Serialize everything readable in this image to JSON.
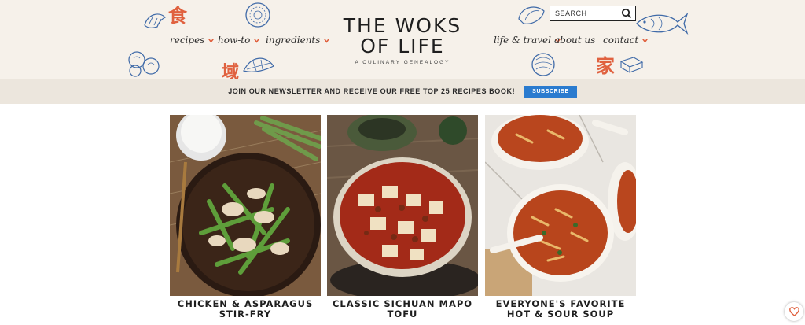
{
  "site": {
    "logo_line1": "THE WOKS",
    "logo_line2": "OF LIFE",
    "tagline": "A CULINARY GENEALOGY"
  },
  "nav": {
    "left": [
      "recipes",
      "how-to",
      "ingredients"
    ],
    "right": [
      "life & travel",
      "about us",
      "contact"
    ]
  },
  "search": {
    "placeholder": "SEARCH"
  },
  "newsletter": {
    "text": "JOIN OUR NEWSLETTER AND RECEIVE OUR FREE TOP 25 RECIPES BOOK!",
    "button": "SUBSCRIBE"
  },
  "recipes": [
    {
      "title_line1": "CHICKEN & ASPARAGUS",
      "title_line2": "STIR-FRY"
    },
    {
      "title_line1": "CLASSIC SICHUAN MAPO",
      "title_line2": "TOFU"
    },
    {
      "title_line1": "EVERYONE'S FAVORITE",
      "title_line2": "HOT & SOUR SOUP"
    }
  ],
  "decor": {
    "char_food": "食",
    "char_home": "家",
    "char_city": "域"
  },
  "colors": {
    "accent": "#e0613f",
    "header_bg": "#f6f1ea",
    "subscribe": "#2a7bcf",
    "ink_blue": "#3f6aa8"
  },
  "icons": [
    "search-icon",
    "chevron-down-icon",
    "heart-icon",
    "fish-icon",
    "dumpling-icon",
    "shrimp-icon",
    "cabbage-icon",
    "bok-choy-icon",
    "bowl-icon"
  ]
}
